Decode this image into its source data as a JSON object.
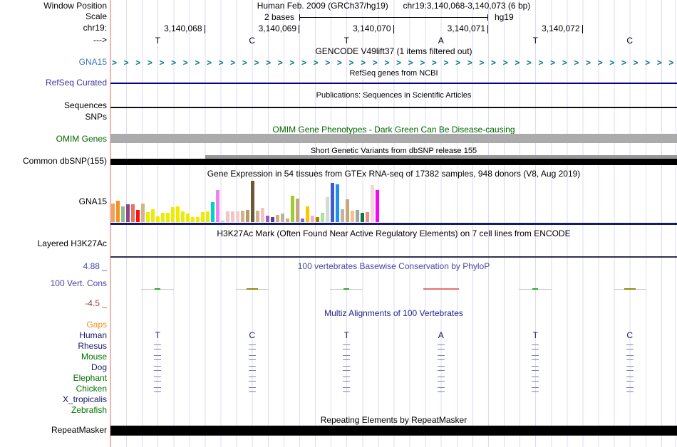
{
  "header": {
    "window_position_label": "Window Position",
    "assembly_title": "Human Feb. 2009 (GRCh37/hg19)",
    "position_title": "chr19:3,140,068-3,140,073 (6 bp)",
    "scale_label": "Scale",
    "scale_value": "2 bases",
    "scale_right": "hg19",
    "chrom_label": "chr19:",
    "strand_label": "--->",
    "coordinates": [
      "3,140,068",
      "3,140,069",
      "3,140,070",
      "3,140,071",
      "3,140,072"
    ],
    "bases": [
      "T",
      "C",
      "T",
      "A",
      "T",
      "C"
    ]
  },
  "tracks": {
    "gencode": {
      "title": "GENCODE V49lift37 (1 items filtered out)",
      "gene_label": "GNA15",
      "color": "#0C7489"
    },
    "refseq": {
      "title": "RefSeq genes from NCBI",
      "label": "RefSeq Curated",
      "line_color": "#000080"
    },
    "publications": {
      "title": "Publications: Sequences in Scientific Articles",
      "label": "Sequences"
    },
    "snps": {
      "label": "SNPs"
    },
    "omim": {
      "title": "OMIM Gene Phenotypes - Dark Green Can Be Disease-causing",
      "label": "OMIM Genes",
      "bar_color": "#ABABAB",
      "text_color": "#006600"
    },
    "dbsnp": {
      "title": "Short Genetic Variants from dbSNP release 155",
      "label": "Common dbSNP(155)",
      "bar_color": "#000000",
      "partial_bar_color": "#979797"
    },
    "gtex": {
      "title": "Gene Expression in 54 tissues from GTEx RNA-seq of 17382 samples, 948 donors (V8, Aug 2019)",
      "label": "GNA15",
      "baseline_color": "#191970"
    },
    "h3k27ac": {
      "title": "H3K27Ac Mark (Often Found Near Active Regulatory Elements) on 7 cell lines from ENCODE",
      "label": "Layered H3K27Ac"
    },
    "conservation": {
      "title": "100 vertebrates Basewise Conservation by PhyloP",
      "label": "100 Vert. Cons",
      "max_value": "4.88 _",
      "min_value": "-4.5 _",
      "marks": [
        {
          "color": "#22AA22",
          "width": 8
        },
        {
          "color": "#8B8B00",
          "width": 16
        },
        {
          "color": "#22AA22",
          "width": 8
        },
        {
          "color": "#E87070",
          "width": 50
        },
        {
          "color": "#22AA22",
          "width": 8
        },
        {
          "color": "#8B8B00",
          "width": 16
        }
      ]
    },
    "multiz": {
      "title": "Multiz Alignments of 100 Vertebrates",
      "match_mark_color": "#7E7EB4",
      "species": [
        {
          "name": "Gaps",
          "color": "#E8951C",
          "type": "empty"
        },
        {
          "name": "Human",
          "color": "#16166A",
          "type": "bases"
        },
        {
          "name": "Rhesus",
          "color": "#16166A",
          "type": "align"
        },
        {
          "name": "Mouse",
          "color": "#007200",
          "type": "align"
        },
        {
          "name": "Dog",
          "color": "#16166A",
          "type": "align"
        },
        {
          "name": "Elephant",
          "color": "#007200",
          "type": "align"
        },
        {
          "name": "Chicken",
          "color": "#007200",
          "type": "align"
        },
        {
          "name": "X_tropicalis",
          "color": "#16166A",
          "type": "empty"
        },
        {
          "name": "Zebrafish",
          "color": "#007200",
          "type": "empty"
        }
      ]
    },
    "repeatmasker": {
      "title": "Repeating Elements by RepeatMasker",
      "label": "RepeatMasker",
      "bar_color": "#000000"
    }
  },
  "chart_data": {
    "type": "bar",
    "title": "Gene Expression in 54 tissues from GTEx RNA-seq of 17382 samples, 948 donors (V8, Aug 2019)",
    "gene": "GNA15",
    "ylabel": "relative expression (unlabeled axis, values estimated in px, max 58)",
    "values": [
      26,
      30,
      22,
      25,
      25,
      17,
      26,
      14,
      18,
      8,
      13,
      13,
      21,
      22,
      15,
      12,
      7,
      7,
      14,
      15,
      28,
      45,
      2,
      15,
      15,
      15,
      16,
      17,
      58,
      16,
      20,
      9,
      7,
      10,
      12,
      5,
      37,
      33,
      5,
      22,
      9,
      7,
      13,
      35,
      55,
      53,
      18,
      32,
      16,
      17,
      13,
      14,
      52,
      45
    ],
    "colors": [
      "#F4A05A",
      "#F59222",
      "#8FBC8F",
      "#8B4789",
      "#E9735A",
      "#FF1010",
      "#D2B48C",
      "#ECEC00",
      "#ECEC00",
      "#ECEC00",
      "#ECEC00",
      "#ECEC00",
      "#ECEC00",
      "#ECEC00",
      "#ECEC00",
      "#ECEC00",
      "#ECEC00",
      "#ECEC00",
      "#ECEC00",
      "#ECEC00",
      "#00CED1",
      "#EE82EE",
      "#C8C8C8",
      "#F2C4C4",
      "#EFC6C6",
      "#F4CCCC",
      "#D2B48C",
      "#B49B6A",
      "#6F5837",
      "#D2B48C",
      "#F2C4C4",
      "#9560BE",
      "#5F3A8E",
      "#CDAF82",
      "#BDB2A4",
      "#CDAF82",
      "#9ACD32",
      "#C8A878",
      "#7A6AD8",
      "#F5C800",
      "#F7AEBE",
      "#A98600",
      "#A8E4A0",
      "#D8D8D8",
      "#3A5FCD",
      "#2090F0",
      "#BEB5A8",
      "#C8A878",
      "#F5C08A",
      "#A6A6A6",
      "#0A7A40",
      "#EE8C8C",
      "#EFD9D9",
      "#FF00FF"
    ]
  }
}
